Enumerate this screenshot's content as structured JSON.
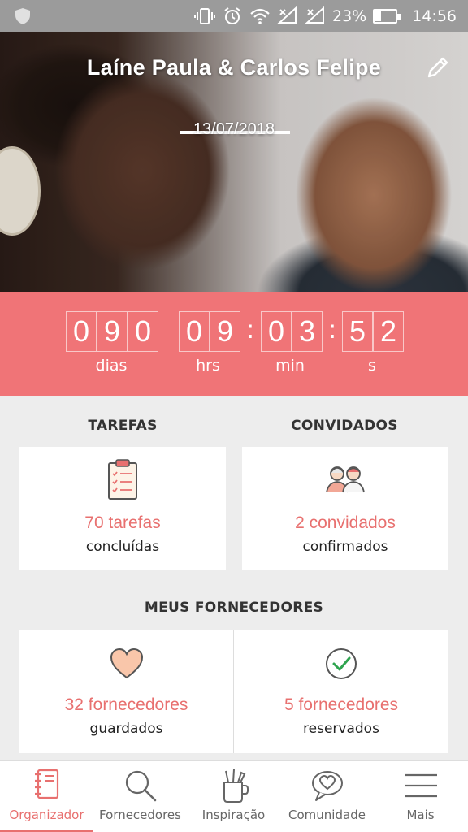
{
  "status_bar": {
    "battery": "23%",
    "time": "14:56",
    "icons": [
      "shield-icon",
      "vibrate-icon",
      "alarm-icon",
      "wifi-icon",
      "signal-icon",
      "signal-icon",
      "battery-icon"
    ]
  },
  "hero": {
    "couple_names": "Laíne Paula & Carlos Felipe",
    "wedding_date": "13/07/2018",
    "edit_icon": "pencil-icon"
  },
  "countdown": {
    "days_digits": [
      "0",
      "9",
      "0"
    ],
    "hours_digits": [
      "0",
      "9"
    ],
    "minutes_digits": [
      "0",
      "3"
    ],
    "seconds_digits": [
      "5",
      "2"
    ],
    "labels": {
      "days": "dias",
      "hours": "hrs",
      "minutes": "min",
      "seconds": "s"
    }
  },
  "tasks": {
    "title": "TAREFAS",
    "count": "70 tarefas",
    "subtitle": "concluídas",
    "icon": "clipboard-checklist-icon"
  },
  "guests": {
    "title": "CONVIDADOS",
    "count": "2 convidados",
    "subtitle": "confirmados",
    "icon": "guests-icon"
  },
  "vendors": {
    "title": "MEUS FORNECEDORES",
    "saved": {
      "count": "32 fornecedores",
      "subtitle": "guardados",
      "icon": "heart-icon"
    },
    "booked": {
      "count": "5 fornecedores",
      "subtitle": "reservados",
      "icon": "check-circle-icon"
    }
  },
  "bottom_nav": {
    "items": [
      {
        "label": "Organizador",
        "icon": "notebook-icon",
        "active": true
      },
      {
        "label": "Fornecedores",
        "icon": "search-icon",
        "active": false
      },
      {
        "label": "Inspiração",
        "icon": "inspiration-cup-icon",
        "active": false
      },
      {
        "label": "Comunidade",
        "icon": "community-chat-icon",
        "active": false
      },
      {
        "label": "Mais",
        "icon": "menu-icon",
        "active": false
      }
    ]
  },
  "colors": {
    "accent": "#f07477",
    "accent_text": "#e8706f",
    "status_bar": "#9b9b9b",
    "background": "#ededed"
  }
}
